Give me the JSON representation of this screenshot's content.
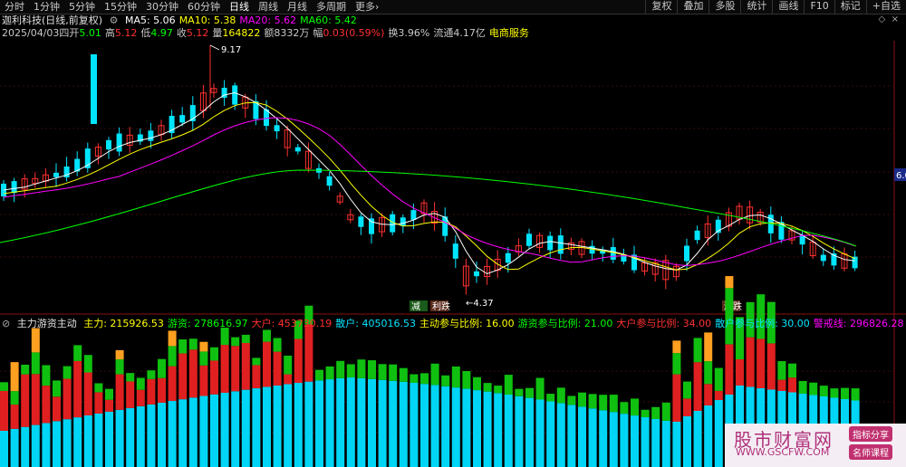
{
  "toolbar": {
    "timeframes": [
      "分时",
      "1分钟",
      "5分钟",
      "15分钟",
      "30分钟",
      "60分钟",
      "日线",
      "周线",
      "月线",
      "多周期",
      "更多›"
    ],
    "active_index": 6,
    "tools": [
      "复权",
      "叠加",
      "多股",
      "统计",
      "画线",
      "F10",
      "标记",
      "+自选"
    ]
  },
  "header": {
    "stock_title": "迦利科技(日线,前复权)",
    "ma": [
      {
        "label": "MA5: 5.06",
        "color": "#ffffff"
      },
      {
        "label": "MA10: 5.38",
        "color": "#ffff00"
      },
      {
        "label": "MA20: 5.62",
        "color": "#ff00ff"
      },
      {
        "label": "MA60: 5.42",
        "color": "#00ff00"
      }
    ]
  },
  "quote": {
    "date": "2025/04/03四",
    "open_label": "开",
    "open": "5.01",
    "high_label": "高",
    "high": "5.12",
    "low_label": "低",
    "low": "4.97",
    "close_label": "收",
    "close": "5.12",
    "vol_label": "量",
    "vol": "164822",
    "amt_label": "额",
    "amt": "8332万",
    "chg_label": "幅",
    "chg": "0.03(0.59%)",
    "turnover": "换3.96%",
    "float": "流通4.17亿",
    "sector": "电商服务"
  },
  "price_chart": {
    "high_mark": "9.17",
    "low_mark": "←4.37",
    "right_tag": "6.0",
    "signals": [
      "减",
      "利跌",
      "涨跌"
    ]
  },
  "indicator": {
    "name": "主力游资主动",
    "items": [
      {
        "label": "主力: 215926.53",
        "color": "#ffff00"
      },
      {
        "label": "游资: 278616.97",
        "color": "#00ff00"
      },
      {
        "label": "大户: 453730.19",
        "color": "#ff3030"
      },
      {
        "label": "散户: 405016.53",
        "color": "#00e5ff"
      },
      {
        "label": "主动参与比例: 16.00",
        "color": "#ffff00"
      },
      {
        "label": "游资参与比例: 21.00",
        "color": "#00ff00"
      },
      {
        "label": "大户参与比例: 34.00",
        "color": "#ff3030"
      },
      {
        "label": "散户参与比例: 30.00",
        "color": "#00e5ff"
      },
      {
        "label": "警戒线: 296826.28",
        "color": "#ff00ff"
      }
    ]
  },
  "watermark": {
    "logo": "股市财富网",
    "url": "WWW.GSCFW.COM",
    "badge1": "指标分享",
    "badge2": "名师课程"
  },
  "colors": {
    "up": "#ff3030",
    "down": "#00e5ff",
    "ma5": "#ffffff",
    "ma10": "#ffff00",
    "ma20": "#ff00ff",
    "ma60": "#00ff00"
  }
}
